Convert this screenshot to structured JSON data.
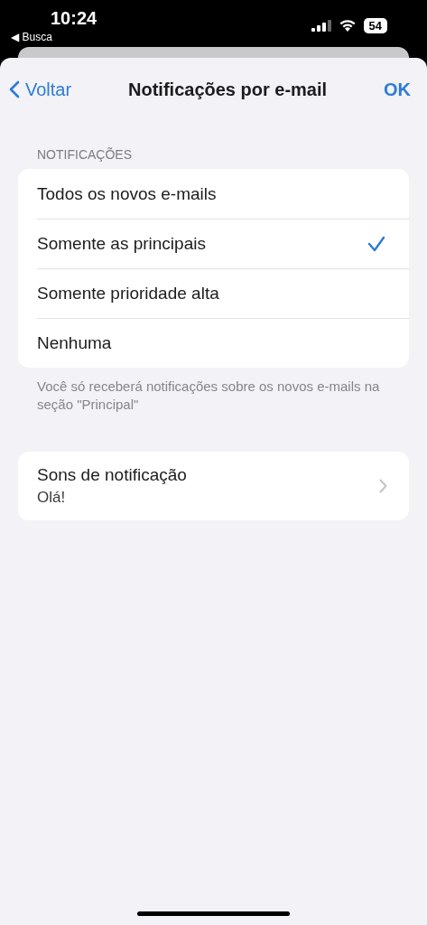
{
  "status_bar": {
    "time": "10:24",
    "back_app": "◀ Busca",
    "battery": "54"
  },
  "nav": {
    "back": "Voltar",
    "title": "Notificações por e-mail",
    "done": "OK"
  },
  "notifications": {
    "header": "NOTIFICAÇÕES",
    "options": [
      {
        "label": "Todos os novos e-mails",
        "selected": false
      },
      {
        "label": "Somente as principais",
        "selected": true
      },
      {
        "label": "Somente prioridade alta",
        "selected": false
      },
      {
        "label": "Nenhuma",
        "selected": false
      }
    ],
    "footer": "Você só receberá notificações sobre os novos e-mails na seção \"Principal\""
  },
  "sounds": {
    "label": "Sons de notificação",
    "value": "Olá!"
  }
}
